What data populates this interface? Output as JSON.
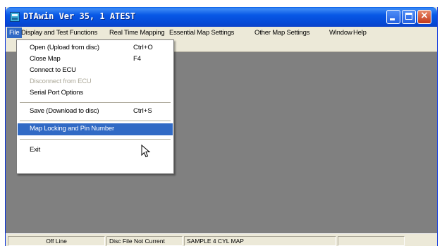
{
  "window": {
    "title": "DTAwin Ver  35, 1  ATEST",
    "controls": {
      "minimize": "minimize-icon",
      "maximize": "maximize-icon",
      "close": "close-icon",
      "close_glyph": "×"
    }
  },
  "menubar": {
    "items": [
      {
        "label": "File",
        "active": true
      },
      {
        "label": "Display and Test Functions"
      },
      {
        "label": "Real Time Mapping"
      },
      {
        "label": "Essential Map Settings"
      },
      {
        "label": "Other Map Settings"
      },
      {
        "label": "Window"
      },
      {
        "label": "Help"
      }
    ]
  },
  "file_menu": {
    "items": [
      {
        "label": "Open (Upload from disc)",
        "shortcut": "Ctrl+O"
      },
      {
        "label": "Close Map",
        "shortcut": "F4"
      },
      {
        "label": "Connect to ECU",
        "shortcut": ""
      },
      {
        "label": "Disconnect from ECU",
        "shortcut": "",
        "disabled": true
      },
      {
        "label": "Serial Port Options",
        "shortcut": ""
      },
      {
        "label": "Save  (Download to disc)",
        "shortcut": "Ctrl+S"
      },
      {
        "label": "Map Locking and Pin Number",
        "shortcut": "",
        "highlighted": true
      },
      {
        "label": "Exit",
        "shortcut": ""
      }
    ]
  },
  "statusbar": {
    "cells": [
      "Off Line",
      "Disc File Not Current",
      "SAMPLE 4 CYL MAP",
      ""
    ]
  },
  "colors": {
    "titlebar": "#0858e6",
    "menu_highlight": "#316ac5",
    "client_area": "#808080",
    "chrome": "#ece9d8"
  }
}
